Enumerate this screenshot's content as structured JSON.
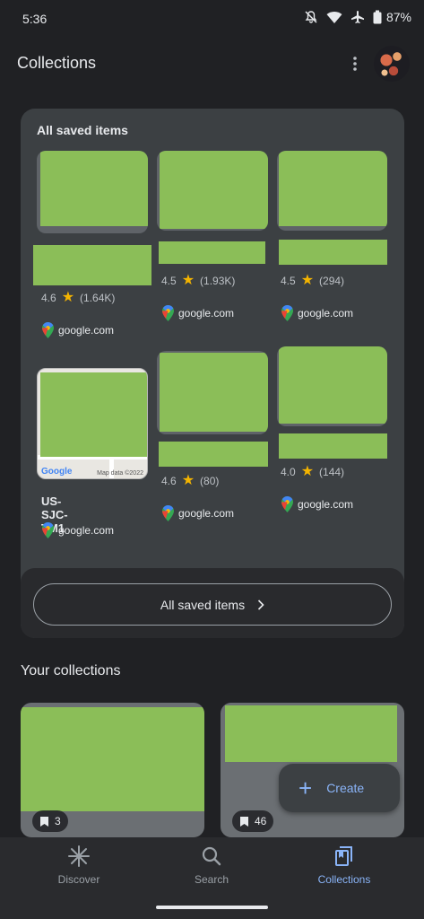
{
  "status": {
    "time": "5:36",
    "battery": "87%"
  },
  "header": {
    "title": "Collections"
  },
  "saved": {
    "heading": "All saved items",
    "items": [
      {
        "rating": "4.6",
        "count": "(1.64K)",
        "source": "google.com"
      },
      {
        "rating": "4.5",
        "count": "(1.93K)",
        "source": "google.com"
      },
      {
        "rating": "4.5",
        "count": "(294)",
        "source": "google.com"
      },
      {
        "title": "US-SJC-TM1",
        "source": "google.com",
        "map_logo": "Google",
        "map_copyright": "Map data ©2022"
      },
      {
        "rating": "4.6",
        "count": "(80)",
        "source": "google.com"
      },
      {
        "rating": "4.0",
        "count": "(144)",
        "source": "google.com"
      }
    ],
    "button_label": "All saved items"
  },
  "collections": {
    "heading": "Your collections",
    "cards": [
      {
        "count": "3"
      },
      {
        "count": "46"
      }
    ]
  },
  "fab": {
    "label": "Create"
  },
  "nav": {
    "discover": "Discover",
    "search": "Search",
    "collections": "Collections"
  },
  "colors": {
    "accent": "#8ab4f8",
    "star": "#f4b400",
    "redacted": "#8bbe58"
  }
}
